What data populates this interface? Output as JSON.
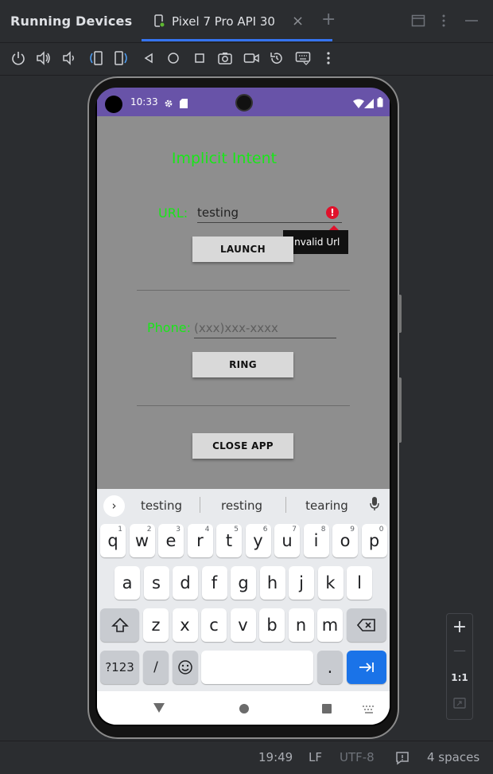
{
  "ide": {
    "panel_title": "Running Devices",
    "tab_label": "Pixel 7 Pro API 30",
    "tab_close": "×",
    "tab_add": "+",
    "accent": "#3574f0"
  },
  "toolbar_icons": [
    "power-icon",
    "volume-up-icon",
    "volume-down-icon",
    "rotate-left-icon",
    "rotate-right-icon",
    "back-icon",
    "home-icon",
    "overview-icon",
    "screenshot-icon",
    "screen-record-icon",
    "reset-icon",
    "keyboard-icon",
    "more-icon"
  ],
  "status_bar": {
    "time": "10:33",
    "color": "#6853a8"
  },
  "app": {
    "title": "Implicit Intent",
    "url_label": "URL:",
    "url_value": "testing",
    "error_icon": "!",
    "tooltip": "Invalid Url",
    "launch_button": "LAUNCH",
    "phone_label": "Phone:",
    "phone_placeholder": "(xxx)xxx-xxxx",
    "ring_button": "RING",
    "close_button": "CLOSE APP",
    "label_color": "#19e619",
    "background": "#8e8e8e"
  },
  "keyboard": {
    "expand": "›",
    "suggestions": [
      "testing",
      "resting",
      "tearing"
    ],
    "row1": [
      {
        "k": "q",
        "n": "1"
      },
      {
        "k": "w",
        "n": "2"
      },
      {
        "k": "e",
        "n": "3"
      },
      {
        "k": "r",
        "n": "4"
      },
      {
        "k": "t",
        "n": "5"
      },
      {
        "k": "y",
        "n": "6"
      },
      {
        "k": "u",
        "n": "7"
      },
      {
        "k": "i",
        "n": "8"
      },
      {
        "k": "o",
        "n": "9"
      },
      {
        "k": "p",
        "n": "0"
      }
    ],
    "row2": [
      "a",
      "s",
      "d",
      "f",
      "g",
      "h",
      "j",
      "k",
      "l"
    ],
    "row3": [
      "z",
      "x",
      "c",
      "v",
      "b",
      "n",
      "m"
    ],
    "symbols_key": "?123",
    "slash_key": "/",
    "period_key": ".",
    "enter_color": "#1a73e8"
  },
  "zoom_panel": {
    "zoom_in": "+",
    "zoom_out": "—",
    "actual_size": "1:1"
  },
  "status": {
    "position": "19:49",
    "line_sep": "LF",
    "encoding": "UTF-8",
    "indent": "4 spaces"
  }
}
